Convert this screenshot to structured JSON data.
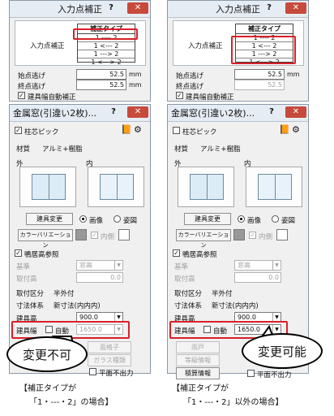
{
  "left": {
    "dialog1": {
      "title": "入力点補正",
      "help_icon": "question-icon",
      "close_label": "✕",
      "row_label": "入力点補正",
      "table_header": "補正タイプ",
      "table_rows": [
        "1 ---- 2",
        "1 <--- 2",
        "1 ---> 2",
        "1 <---> 2"
      ],
      "start_label": "始点逃げ",
      "start_value": "52.5",
      "end_label": "終点逃げ",
      "end_value": "52.5",
      "unit": "mm",
      "auto_check_label": "建具幅自動補正",
      "auto_checked": true
    },
    "dialog2": {
      "title": "金属窓(引違い2枚)...",
      "help_icon": "question-icon",
      "close_label": "✕",
      "pillar_pick_label": "柱芯ピック",
      "pillar_pick_checked": true,
      "material_label": "材質",
      "material_value": "アルミ+樹脂",
      "outside_label": "外",
      "inside_label": "内",
      "change_button": "建具変更",
      "radio_image": "画像",
      "radio_figure": "姿図",
      "color_button": "カラーバリエーション",
      "inside_same_label": "内側",
      "eave_label": "鴨居高参照",
      "eave_checked": true,
      "base_label": "基準",
      "base_value": "窓高",
      "height_label": "取付高",
      "height_value": "0.0",
      "install_label": "取付区分",
      "install_value": "半外付",
      "dimension_label": "寸法体系",
      "dimension_value": "新寸法(内内内)",
      "fitting_height_label": "建具高",
      "fitting_height_value": "900.0",
      "fitting_width_label": "建具幅",
      "auto_label": "自動",
      "auto_checked": false,
      "fitting_width_value": "1650.0",
      "lattice_button": "面格子",
      "glass_button": "ガラス種類",
      "no_output_label": "平面不出力",
      "bubble_text": "変更不可",
      "caption_line1": "【補正タイプが",
      "caption_line2": "「1・---・2」の場合】"
    }
  },
  "right": {
    "dialog1": {
      "title": "入力点補正",
      "help_icon": "question-icon",
      "close_label": "✕",
      "row_label": "入力点補正",
      "table_header": "補正タイプ",
      "table_rows": [
        "1 ---- 2",
        "1 <--- 2",
        "1 ---> 2",
        "1 <---> 2"
      ],
      "start_label": "始点逃げ",
      "start_value": "52.5",
      "end_label": "終点逃げ",
      "end_value": "52.5",
      "unit": "mm",
      "auto_check_label": "建具幅自動補正",
      "auto_checked": true
    },
    "dialog2": {
      "title": "金属窓(引違い2枚)...",
      "help_icon": "question-icon",
      "close_label": "✕",
      "pillar_pick_label": "柱芯ピック",
      "pillar_pick_checked": false,
      "material_label": "材質",
      "material_value": "アルミ+樹脂",
      "outside_label": "外",
      "inside_label": "内",
      "change_button": "建具変更",
      "radio_image": "画像",
      "radio_figure": "姿図",
      "color_button": "カラーバリエーション",
      "inside_same_label": "内側",
      "eave_label": "鴨居高参照",
      "eave_checked": true,
      "base_label": "基準",
      "base_value": "窓高",
      "height_label": "取付高",
      "height_value": "0.0",
      "install_label": "取付区分",
      "install_value": "半外付",
      "dimension_label": "寸法体系",
      "dimension_value": "新寸法(内内内)",
      "fitting_height_label": "建具高",
      "fitting_height_value": "900.0",
      "fitting_width_label": "建具幅",
      "auto_label": "自動",
      "auto_checked": false,
      "fitting_width_value": "1650.0",
      "rain_door_button": "雨戸",
      "fitting_info_button": "等級情報",
      "calc_info_button": "積算情報",
      "no_output_label": "平面不出力",
      "bubble_text": "変更可能",
      "caption_line1": "【補正タイプが",
      "caption_line2": "「1・---・2」以外の場合】"
    }
  }
}
